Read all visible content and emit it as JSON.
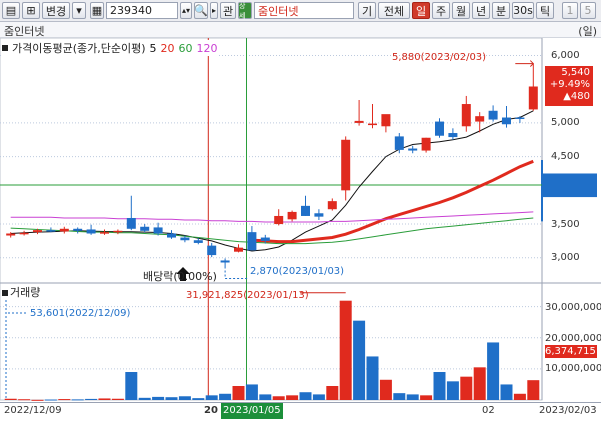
{
  "toolbar": {
    "change_label": "변경",
    "code_value": "239340",
    "button_a": "관",
    "button_b": "상세",
    "stock_name": "줌인터넷",
    "buttons": [
      "기",
      "전체",
      "일",
      "주",
      "월",
      "년",
      "분",
      "30s",
      "틱"
    ],
    "active_index": 2,
    "extra": [
      "1",
      "5"
    ]
  },
  "subheader": {
    "name": "줌인터넷",
    "period": "(일)"
  },
  "legend": {
    "title": "가격이동평균(종가,단순이평)",
    "ma": [
      "5",
      "20",
      "60",
      "120"
    ]
  },
  "annotations": {
    "high": "5,880(2023/02/03)",
    "low": "2,870(2023/01/03)",
    "dividend": "배당락(0.00%)",
    "vol_high": "31,921,825(2023/01/13)",
    "vol_low": "53,601(2022/12/09)"
  },
  "price_box": {
    "price": "5,540",
    "change_pct": "+9.49%",
    "change_abs": "▲480"
  },
  "volume_panel": {
    "title": "거래량",
    "current": "6,374,715"
  },
  "axis": {
    "price_ticks": [
      "6,000",
      "5,000",
      "4,500",
      "3,500",
      "3,000"
    ],
    "volume_ticks": [
      "30,000,000",
      "20,000,000",
      "10,000,000"
    ],
    "dates": [
      "2022/12/09",
      "20",
      "2023/01/05",
      "02",
      "2023/02/03"
    ]
  },
  "colors": {
    "up": "#e02a1e",
    "down": "#1f6fc8",
    "ma5": "#111111",
    "ma20": "#e02a1e",
    "ma60": "#2a9d3a",
    "ma120": "#c940d3"
  },
  "chart_data": [
    {
      "type": "candlestick",
      "title": "가격이동평균(종가,단순이평)",
      "ylim": [
        2700,
        6200
      ],
      "candles": [
        {
          "o": 3330,
          "h": 3380,
          "l": 3300,
          "c": 3360
        },
        {
          "o": 3360,
          "h": 3400,
          "l": 3330,
          "c": 3370
        },
        {
          "o": 3380,
          "h": 3430,
          "l": 3350,
          "c": 3410
        },
        {
          "o": 3410,
          "h": 3450,
          "l": 3380,
          "c": 3390
        },
        {
          "o": 3390,
          "h": 3460,
          "l": 3360,
          "c": 3430
        },
        {
          "o": 3430,
          "h": 3450,
          "l": 3360,
          "c": 3400
        },
        {
          "o": 3420,
          "h": 3490,
          "l": 3340,
          "c": 3360
        },
        {
          "o": 3360,
          "h": 3420,
          "l": 3340,
          "c": 3380
        },
        {
          "o": 3380,
          "h": 3420,
          "l": 3350,
          "c": 3400
        },
        {
          "o": 3590,
          "h": 3920,
          "l": 3410,
          "c": 3430
        },
        {
          "o": 3460,
          "h": 3500,
          "l": 3380,
          "c": 3400
        },
        {
          "o": 3450,
          "h": 3520,
          "l": 3330,
          "c": 3360
        },
        {
          "o": 3360,
          "h": 3410,
          "l": 3280,
          "c": 3300
        },
        {
          "o": 3300,
          "h": 3330,
          "l": 3230,
          "c": 3260
        },
        {
          "o": 3260,
          "h": 3290,
          "l": 3200,
          "c": 3220
        },
        {
          "o": 3180,
          "h": 3220,
          "l": 3010,
          "c": 3040
        },
        {
          "o": 2960,
          "h": 2990,
          "l": 2870,
          "c": 2930
        },
        {
          "o": 3090,
          "h": 3200,
          "l": 3080,
          "c": 3150
        },
        {
          "o": 3380,
          "h": 3470,
          "l": 3110,
          "c": 3110
        },
        {
          "o": 3300,
          "h": 3340,
          "l": 3210,
          "c": 3250
        },
        {
          "o": 3500,
          "h": 3720,
          "l": 3480,
          "c": 3620
        },
        {
          "o": 3570,
          "h": 3700,
          "l": 3540,
          "c": 3680
        },
        {
          "o": 3770,
          "h": 3920,
          "l": 3620,
          "c": 3620
        },
        {
          "o": 3660,
          "h": 3720,
          "l": 3560,
          "c": 3610
        },
        {
          "o": 3720,
          "h": 3880,
          "l": 3700,
          "c": 3840
        },
        {
          "o": 4000,
          "h": 4800,
          "l": 3850,
          "c": 4750
        },
        {
          "o": 5000,
          "h": 5340,
          "l": 4960,
          "c": 5030
        },
        {
          "o": 4980,
          "h": 5280,
          "l": 4920,
          "c": 4990
        },
        {
          "o": 4950,
          "h": 5120,
          "l": 4860,
          "c": 5130
        },
        {
          "o": 4800,
          "h": 4850,
          "l": 4550,
          "c": 4600
        },
        {
          "o": 4620,
          "h": 4660,
          "l": 4550,
          "c": 4590
        },
        {
          "o": 4590,
          "h": 4780,
          "l": 4560,
          "c": 4780
        },
        {
          "o": 5020,
          "h": 5070,
          "l": 4780,
          "c": 4810
        },
        {
          "o": 4850,
          "h": 4920,
          "l": 4750,
          "c": 4790
        },
        {
          "o": 4950,
          "h": 5400,
          "l": 4870,
          "c": 5280
        },
        {
          "o": 5020,
          "h": 5160,
          "l": 4860,
          "c": 5100
        },
        {
          "o": 5180,
          "h": 5260,
          "l": 5020,
          "c": 5050
        },
        {
          "o": 5080,
          "h": 5250,
          "l": 4930,
          "c": 4980
        },
        {
          "o": 5080,
          "h": 5100,
          "l": 5000,
          "c": 5060
        },
        {
          "o": 5200,
          "h": 5880,
          "l": 5180,
          "c": 5540
        }
      ],
      "series": [
        {
          "name": "5",
          "values": [
            3360,
            3370,
            3380,
            3385,
            3395,
            3400,
            3395,
            3390,
            3385,
            3385,
            3380,
            3375,
            3360,
            3330,
            3290,
            3250,
            3190,
            3140,
            3100,
            3120,
            3160,
            3260,
            3380,
            3470,
            3560,
            3780,
            4050,
            4280,
            4500,
            4610,
            4680,
            4700,
            4720,
            4750,
            4790,
            4880,
            4980,
            5050,
            5080,
            5180
          ]
        },
        {
          "name": "20",
          "values": [
            null,
            null,
            null,
            null,
            null,
            null,
            null,
            null,
            null,
            null,
            null,
            null,
            null,
            null,
            null,
            null,
            null,
            null,
            3260,
            3250,
            3240,
            3240,
            3260,
            3280,
            3300,
            3350,
            3420,
            3500,
            3580,
            3640,
            3700,
            3760,
            3820,
            3890,
            3970,
            4060,
            4150,
            4250,
            4350,
            4430
          ]
        },
        {
          "name": "60",
          "values": [
            3440,
            3430,
            3420,
            3410,
            3400,
            3390,
            3380,
            3380,
            3370,
            3370,
            3360,
            3350,
            3340,
            3320,
            3300,
            3280,
            3260,
            3240,
            3230,
            3220,
            3210,
            3210,
            3210,
            3220,
            3230,
            3250,
            3280,
            3310,
            3340,
            3370,
            3400,
            3430,
            3450,
            3470,
            3490,
            3510,
            3530,
            3550,
            3570,
            3590
          ]
        },
        {
          "name": "120",
          "values": [
            3600,
            3600,
            3600,
            3600,
            3590,
            3590,
            3590,
            3590,
            3580,
            3580,
            3580,
            3570,
            3570,
            3560,
            3560,
            3550,
            3550,
            3540,
            3540,
            3530,
            3530,
            3530,
            3530,
            3530,
            3540,
            3540,
            3550,
            3560,
            3570,
            3580,
            3590,
            3600,
            3610,
            3620,
            3630,
            3640,
            3650,
            3660,
            3670,
            3680
          ]
        }
      ]
    },
    {
      "type": "bar",
      "title": "거래량",
      "ylim": [
        0,
        36000000
      ],
      "values": [
        400000,
        250000,
        53601,
        150000,
        300000,
        200000,
        350000,
        500000,
        400000,
        9000000,
        700000,
        1000000,
        900000,
        1200000,
        600000,
        1500000,
        2000000,
        4500000,
        5000000,
        1800000,
        1200000,
        1500000,
        2500000,
        1800000,
        4500000,
        31921825,
        25500000,
        14000000,
        6500000,
        2200000,
        1800000,
        1500000,
        9000000,
        6000000,
        7500000,
        10500000,
        18500000,
        5000000,
        2000000,
        6374715
      ],
      "up": [
        true,
        true,
        true,
        false,
        true,
        false,
        false,
        true,
        true,
        false,
        false,
        false,
        false,
        false,
        false,
        false,
        false,
        true,
        false,
        false,
        true,
        true,
        false,
        false,
        true,
        true,
        false,
        false,
        true,
        false,
        false,
        true,
        false,
        false,
        true,
        true,
        false,
        false,
        true,
        true
      ]
    }
  ]
}
